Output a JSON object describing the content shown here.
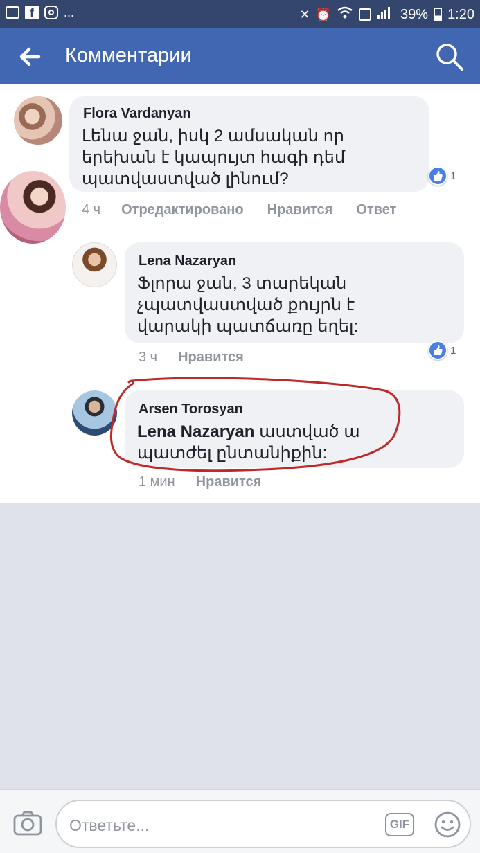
{
  "status_bar": {
    "dots": "...",
    "battery": "39%",
    "time": "1:20"
  },
  "header": {
    "title": "Комментарии"
  },
  "comments": [
    {
      "author": "Flora Vardanyan",
      "text": "Լենա ջան, իսկ 2 ամսական որ\nերեխան է կապույտ հագի դեմ\nպատվաստված լինում?",
      "time": "4 ч",
      "edited": "Отредактировано",
      "like": "Нравится",
      "reply": "Ответ",
      "reaction_count": "1"
    },
    {
      "author": "Lena Nazaryan",
      "text": "Ֆլորա ջան, 3 տարեկան\nչպատվաստված քույրն է\nվարակի պատճառը եղել:",
      "time": "3 ч",
      "like": "Нравится",
      "reaction_count": "1"
    },
    {
      "author": "Arsen Torosyan",
      "mention": "Lena Nazaryan",
      "text": " աստված ա\nպատժել ընտանիքին:",
      "time": "1 мин",
      "like": "Нравится"
    }
  ],
  "composer": {
    "placeholder": "Ответьте...",
    "gif_label": "GIF"
  },
  "colors": {
    "header_bg": "#4267b2",
    "statusbar_bg": "#34466e",
    "highlight_ring": "#c0282a"
  }
}
